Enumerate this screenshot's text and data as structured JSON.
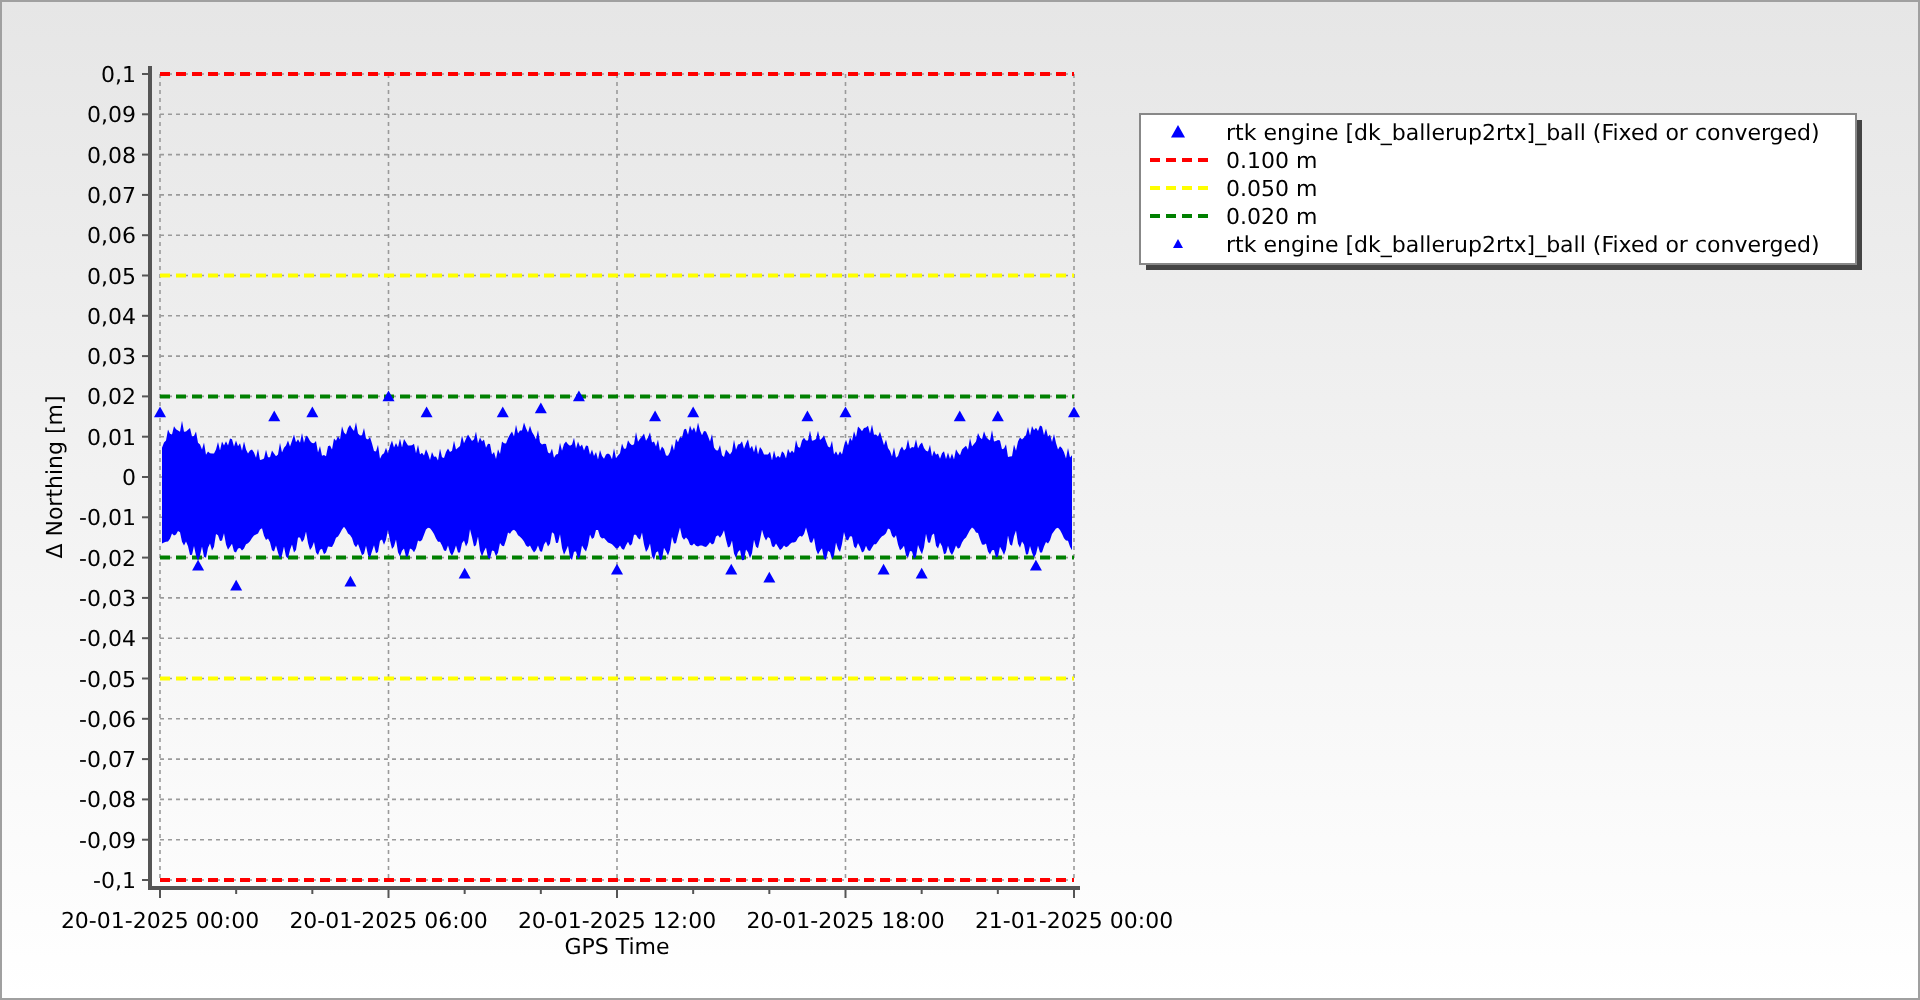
{
  "chart": {
    "chart_data": {
      "type": "scatter",
      "xlabel": "GPS Time",
      "ylabel": "Δ Northing [m]",
      "categories": [
        "20-01-2025 00:00",
        null,
        null,
        null,
        null,
        null,
        "20-01-2025 06:00",
        null,
        null,
        null,
        null,
        null,
        "20-01-2025 12:00",
        null,
        null,
        null,
        null,
        null,
        "20-01-2025 18:00",
        null,
        null,
        null,
        null,
        null,
        "21-01-2025 00:00"
      ],
      "ylim": [
        -0.1,
        0.1
      ],
      "grid": true,
      "legend": true,
      "ref_lines": [
        {
          "axis": "y",
          "value": -0.1,
          "color": "#ff0000",
          "line_style": "dashed"
        },
        {
          "axis": "y",
          "value": -0.05,
          "color": "#ffff00",
          "line_style": "dashed"
        },
        {
          "axis": "y",
          "value": -0.02,
          "color": "#008000",
          "line_style": "dashed"
        }
      ],
      "yticks": [
        {
          "value": 0.1,
          "label": "0,1"
        },
        {
          "value": 0.09,
          "label": "0,09"
        },
        {
          "value": 0.08,
          "label": "0,08"
        },
        {
          "value": 0.07,
          "label": "0,07"
        },
        {
          "value": 0.06,
          "label": "0,06"
        },
        {
          "value": 0.05,
          "label": "0,05"
        },
        {
          "value": 0.04,
          "label": "0,04"
        },
        {
          "value": 0.03,
          "label": "0,03"
        },
        {
          "value": 0.02,
          "label": "0,02"
        },
        {
          "value": 0.01,
          "label": "0,01"
        },
        {
          "value": 0,
          "label": "0"
        },
        {
          "value": -0.01,
          "label": "-0,01"
        },
        {
          "value": -0.02,
          "label": "-0,02"
        },
        {
          "value": -0.03,
          "label": "-0,03"
        },
        {
          "value": -0.04,
          "label": "-0,04"
        },
        {
          "value": -0.05,
          "label": "-0,05"
        },
        {
          "value": -0.06,
          "label": "-0,06"
        },
        {
          "value": -0.07,
          "label": "-0,07"
        },
        {
          "value": -0.08,
          "label": "-0,08"
        },
        {
          "value": -0.09,
          "label": "-0,09"
        },
        {
          "value": -0.1,
          "label": "-0,1"
        }
      ],
      "series": [
        {
          "name": "rtk engine [dk_ballerup2rtx]_ball (Fixed or converged)",
          "marker": "triangle",
          "color": "#0000ff",
          "values": [
            0.016,
            null,
            -0.027,
            null,
            0.016,
            null,
            0.02,
            null,
            -0.024,
            null,
            0.017,
            null,
            -0.023,
            null,
            0.016,
            null,
            -0.025,
            null,
            0.016,
            null,
            -0.024,
            null,
            0.015,
            null,
            0.016
          ]
        },
        {
          "name": "0.100 m",
          "type": "line",
          "line_style": "dashed",
          "color": "#ff0000",
          "values": [
            0.1,
            0.1,
            0.1,
            0.1,
            0.1,
            0.1,
            0.1,
            0.1,
            0.1,
            0.1,
            0.1,
            0.1,
            0.1,
            0.1,
            0.1,
            0.1,
            0.1,
            0.1,
            0.1,
            0.1,
            0.1,
            0.1,
            0.1,
            0.1,
            0.1
          ]
        },
        {
          "name": "0.050 m",
          "type": "line",
          "line_style": "dashed",
          "color": "#ffff00",
          "values": [
            0.05,
            0.05,
            0.05,
            0.05,
            0.05,
            0.05,
            0.05,
            0.05,
            0.05,
            0.05,
            0.05,
            0.05,
            0.05,
            0.05,
            0.05,
            0.05,
            0.05,
            0.05,
            0.05,
            0.05,
            0.05,
            0.05,
            0.05,
            0.05,
            0.05
          ]
        },
        {
          "name": "0.020 m",
          "type": "line",
          "line_style": "dashed",
          "color": "#008000",
          "values": [
            0.02,
            0.02,
            0.02,
            0.02,
            0.02,
            0.02,
            0.02,
            0.02,
            0.02,
            0.02,
            0.02,
            0.02,
            0.02,
            0.02,
            0.02,
            0.02,
            0.02,
            0.02,
            0.02,
            0.02,
            0.02,
            0.02,
            0.02,
            0.02,
            0.02
          ]
        },
        {
          "name": "rtk engine [dk_ballerup2rtx]_ball (Fixed or converged)",
          "marker": "triangle",
          "color": "#0000ff",
          "values": [
            null,
            -0.022,
            null,
            0.015,
            null,
            -0.026,
            null,
            0.016,
            null,
            0.016,
            null,
            0.02,
            null,
            0.015,
            null,
            -0.023,
            null,
            0.015,
            null,
            -0.023,
            null,
            0.015,
            null,
            -0.022,
            null
          ]
        }
      ]
    }
  }
}
